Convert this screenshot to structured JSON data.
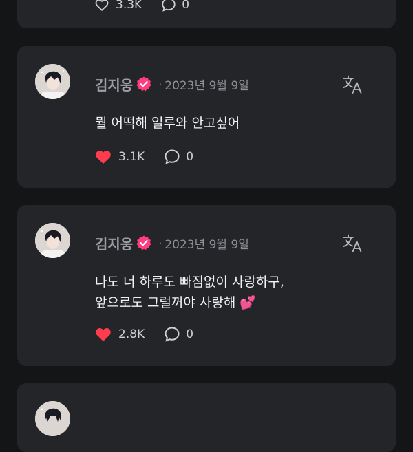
{
  "posts": [
    {
      "author": "김지웅",
      "separator": "·",
      "date": "2023년 9월 9일",
      "text": "뭘 어떡해 일루와 안고싶어",
      "likes": "3.1K",
      "comments": "0"
    },
    {
      "author": "김지웅",
      "separator": "·",
      "date": "2023년 9월 9일",
      "text": "나도 너 하루도 빠짐없이 사랑하구,\n앞으로도 그럴꺼야 사랑해 💕",
      "likes": "2.8K",
      "comments": "0"
    }
  ],
  "top_card": {
    "likes": "3.3K",
    "comments": "0"
  },
  "colors": {
    "background": "#141517",
    "card": "#242529",
    "heart": "#ff3b4e",
    "verified": "#ff3d7f",
    "muted": "#8e9095"
  },
  "icons": [
    "heart-icon",
    "comment-icon",
    "verified-badge-icon",
    "translate-icon"
  ]
}
